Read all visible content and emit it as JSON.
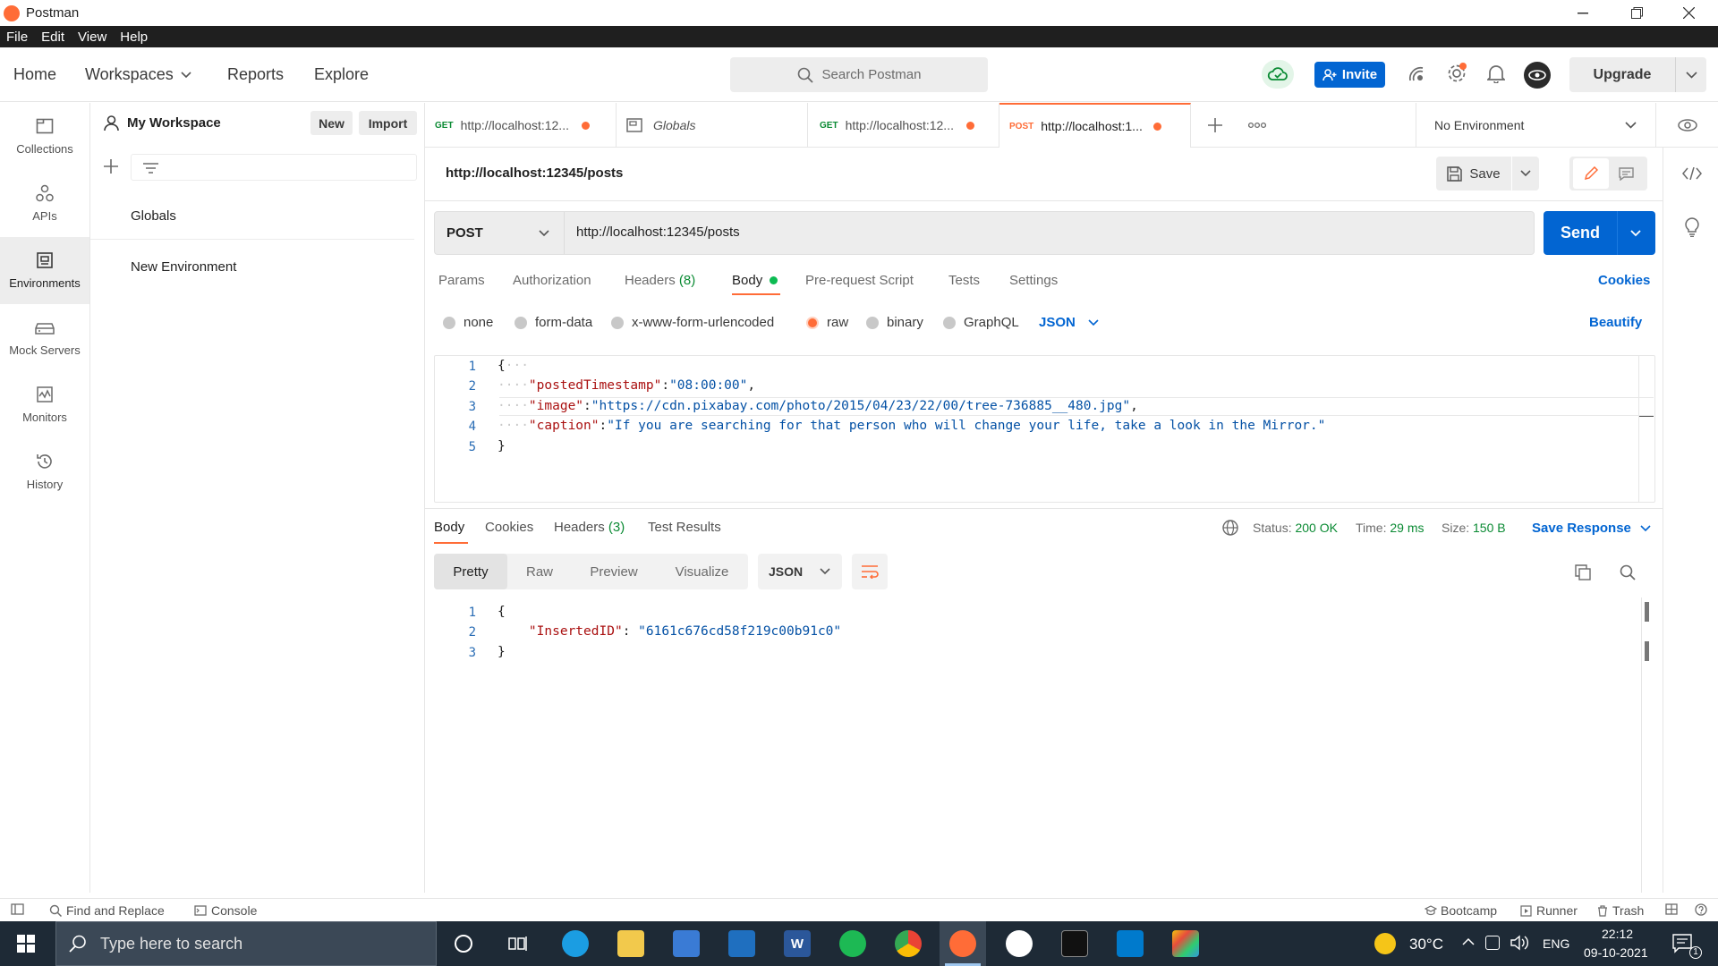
{
  "app": {
    "title": "Postman"
  },
  "menu": [
    "File",
    "Edit",
    "View",
    "Help"
  ],
  "header": {
    "nav": [
      "Home",
      "Workspaces",
      "Reports",
      "Explore"
    ],
    "search_placeholder": "Search Postman",
    "invite_label": "Invite",
    "upgrade_label": "Upgrade"
  },
  "rail": [
    {
      "label": "Collections",
      "icon": "collections-icon"
    },
    {
      "label": "APIs",
      "icon": "apis-icon"
    },
    {
      "label": "Environments",
      "icon": "environments-icon",
      "active": true
    },
    {
      "label": "Mock Servers",
      "icon": "mock-servers-icon"
    },
    {
      "label": "Monitors",
      "icon": "monitors-icon"
    },
    {
      "label": "History",
      "icon": "history-icon"
    }
  ],
  "sidebar": {
    "workspace": "My Workspace",
    "new_label": "New",
    "import_label": "Import",
    "items": [
      "Globals",
      "New Environment"
    ]
  },
  "tabs": [
    {
      "method": "GET",
      "label": "http://localhost:12...",
      "unsaved": true
    },
    {
      "method": "",
      "label": "Globals",
      "unsaved": false
    },
    {
      "method": "GET",
      "label": "http://localhost:12...",
      "unsaved": true
    },
    {
      "method": "POST",
      "label": "http://localhost:1...",
      "unsaved": true,
      "active": true
    }
  ],
  "environment": {
    "selected": "No Environment"
  },
  "request": {
    "title": "http://localhost:12345/posts",
    "save_label": "Save",
    "method": "POST",
    "url": "http://localhost:12345/posts",
    "send_label": "Send",
    "tabs": [
      "Params",
      "Authorization",
      "Headers",
      "(8)",
      "Body",
      "Pre-request Script",
      "Tests",
      "Settings"
    ],
    "cookies_label": "Cookies",
    "body_modes": [
      "none",
      "form-data",
      "x-www-form-urlencoded",
      "raw",
      "binary",
      "GraphQL"
    ],
    "body_format": "JSON",
    "beautify_label": "Beautify",
    "body_lines": [
      {
        "n": "1",
        "text": "{"
      },
      {
        "n": "2",
        "key": "\"postedTimestamp\"",
        "value": "\"08:00:00\"",
        "trail": ","
      },
      {
        "n": "3",
        "key": "\"image\"",
        "value": "\"https://cdn.pixabay.com/photo/2015/04/23/22/00/tree-736885__480.jpg\"",
        "trail": ","
      },
      {
        "n": "4",
        "key": "\"caption\"",
        "value": "\"If you are searching for that person who will change your life, take a look in the Mirror.\"",
        "trail": ""
      },
      {
        "n": "5",
        "text": "}"
      }
    ]
  },
  "response": {
    "tabs": [
      "Body",
      "Cookies",
      "Headers",
      "(3)",
      "Test Results"
    ],
    "status_label": "Status:",
    "status": "200 OK",
    "time_label": "Time:",
    "time": "29 ms",
    "size_label": "Size:",
    "size": "150 B",
    "save_response_label": "Save Response",
    "views": [
      "Pretty",
      "Raw",
      "Preview",
      "Visualize"
    ],
    "format": "JSON",
    "body_lines": [
      {
        "n": "1",
        "text": "{"
      },
      {
        "n": "2",
        "key": "\"InsertedID\"",
        "value": "\"6161c676cd58f219c00b91c0\""
      },
      {
        "n": "3",
        "text": "}"
      }
    ]
  },
  "statusbar": {
    "find_replace": "Find and Replace",
    "console": "Console",
    "bootcamp": "Bootcamp",
    "runner": "Runner",
    "trash": "Trash"
  },
  "taskbar": {
    "search_placeholder": "Type here to search",
    "temperature": "30°C",
    "language": "ENG",
    "time": "22:12",
    "date": "09-10-2021",
    "notifications": "1"
  },
  "colors": {
    "accent": "#ff6c37",
    "primary": "#0265d2",
    "success": "#0a8a33"
  }
}
